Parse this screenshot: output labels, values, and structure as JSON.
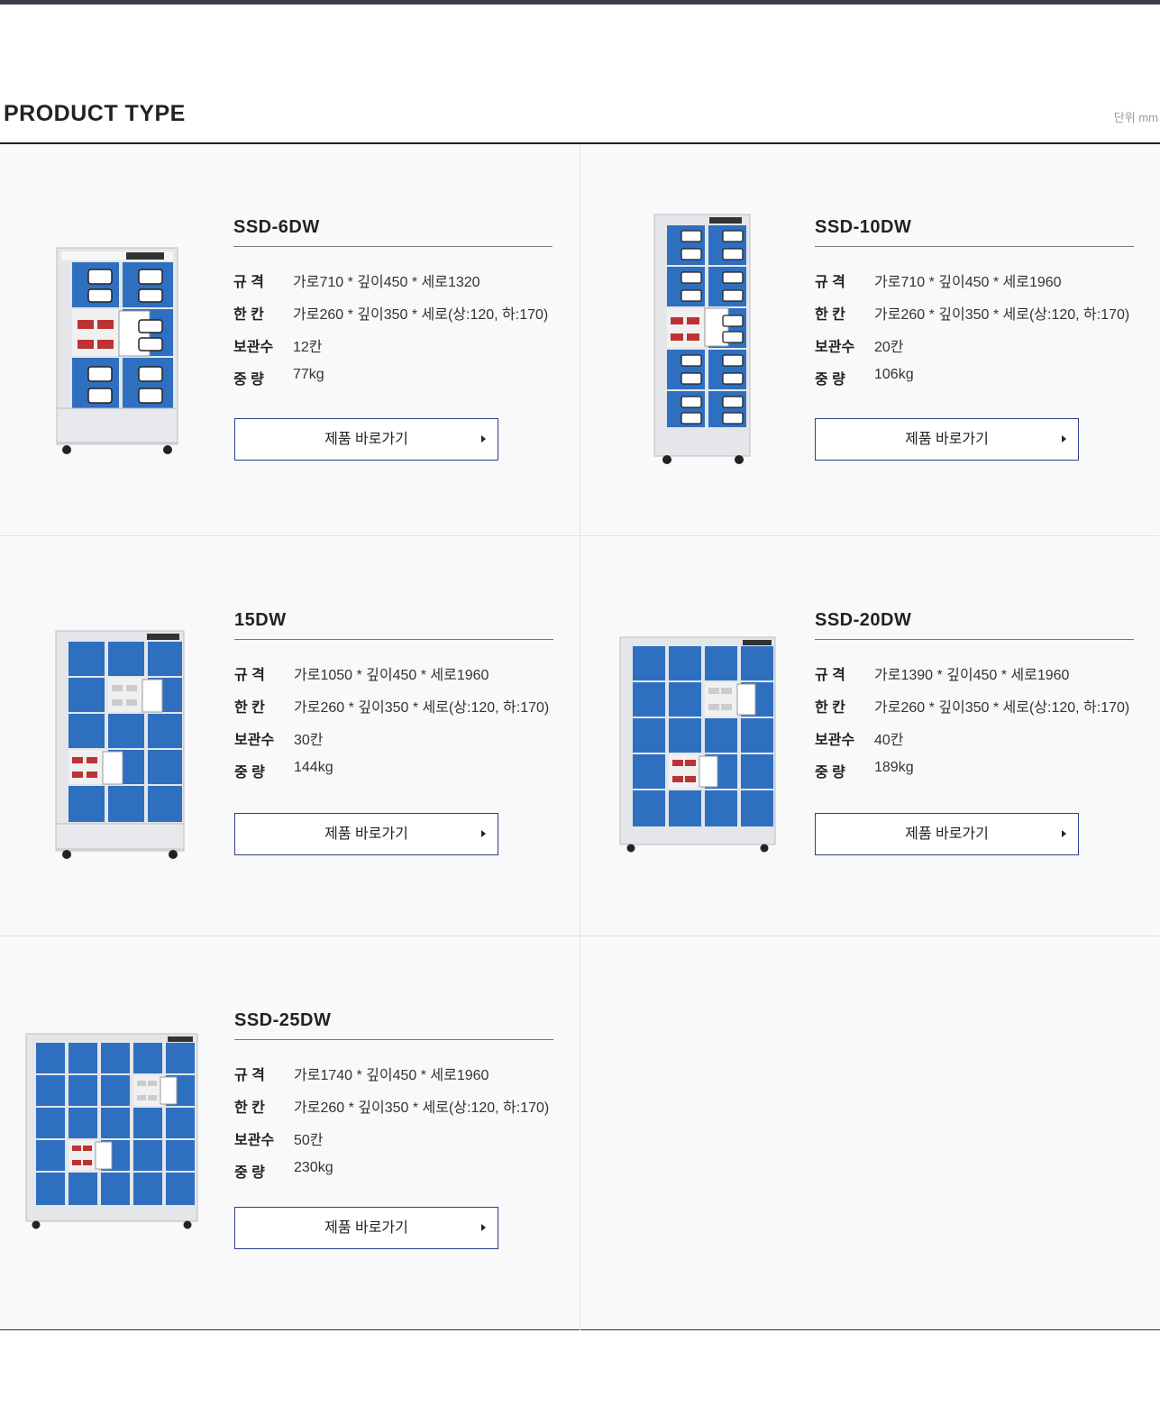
{
  "header": {
    "title": "PRODUCT TYPE",
    "unit": "단위 mm"
  },
  "labels": {
    "spec": "규  격",
    "cell": "한  칸",
    "storage": "보관수",
    "weight": "중  량",
    "button": "제품 바로가기"
  },
  "colors": {
    "accent": "#2c3f8f",
    "locker_blue": "#2f6fc0",
    "frame": "#e4e6ea"
  },
  "products": [
    {
      "model": "SSD-6DW",
      "spec": "가로710 * 깊이450 * 세로1320",
      "cell": "가로260 * 깊이350 * 세로(상:120, 하:170)",
      "storage": "12칸",
      "weight": "77kg"
    },
    {
      "model": "SSD-10DW",
      "spec": "가로710 * 깊이450 * 세로1960",
      "cell": "가로260 * 깊이350 * 세로(상:120, 하:170)",
      "storage": "20칸",
      "weight": "106kg"
    },
    {
      "model": "15DW",
      "spec": "가로1050 * 깊이450 * 세로1960",
      "cell": "가로260 * 깊이350 * 세로(상:120, 하:170)",
      "storage": "30칸",
      "weight": "144kg"
    },
    {
      "model": "SSD-20DW",
      "spec": "가로1390 * 깊이450 * 세로1960",
      "cell": "가로260 * 깊이350 * 세로(상:120, 하:170)",
      "storage": "40칸",
      "weight": "189kg"
    },
    {
      "model": "SSD-25DW",
      "spec": "가로1740 * 깊이450 * 세로1960",
      "cell": "가로260 * 깊이350 * 세로(상:120, 하:170)",
      "storage": "50칸",
      "weight": "230kg"
    }
  ]
}
